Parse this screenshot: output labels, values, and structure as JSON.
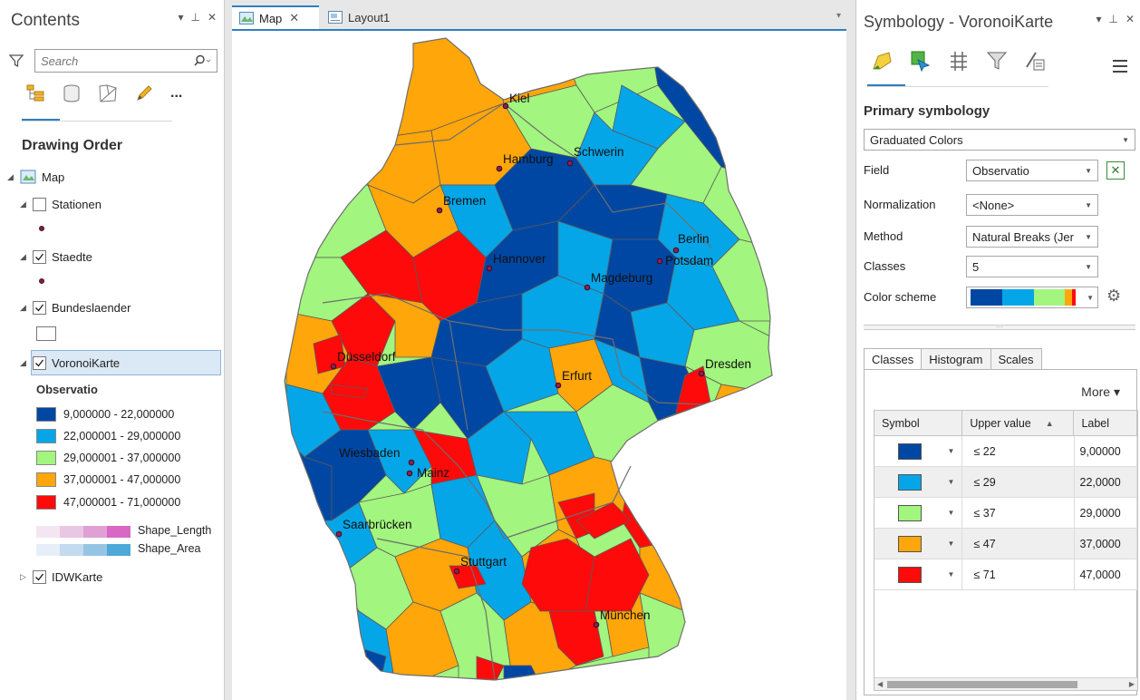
{
  "colors": {
    "class1": "#0047A3",
    "class2": "#04A6E8",
    "class3": "#A2F57E",
    "class4": "#FFA60A",
    "class5": "#FF0A0A",
    "accent": "#2F7FC1"
  },
  "contents": {
    "title": "Contents",
    "ctrl_dropdown": "▾",
    "ctrl_pin": "⊥",
    "ctrl_close": "✕",
    "search_placeholder": "Search",
    "more_label": "...",
    "drawing_order": "Drawing Order",
    "layers": {
      "map": "Map",
      "stationen": "Stationen",
      "staedte": "Staedte",
      "bundeslaender": "Bundeslaender",
      "voronoi": "VoronoiKarte",
      "idw": "IDWKarte"
    },
    "legend_field": "Observatio",
    "legend": [
      {
        "label": "9,000000 - 22,000000"
      },
      {
        "label": "22,000001 - 29,000000"
      },
      {
        "label": "29,000001 - 37,000000"
      },
      {
        "label": "37,000001 - 47,000000"
      },
      {
        "label": "47,000001 - 71,000000"
      }
    ],
    "shape_length": "Shape_Length",
    "shape_area": "Shape_Area"
  },
  "map": {
    "tabs": [
      {
        "label": "Map",
        "close": "✕"
      },
      {
        "label": "Layout1"
      }
    ],
    "tab_dropdown": "▾",
    "cities": [
      {
        "name": "Kiel"
      },
      {
        "name": "Schwerin"
      },
      {
        "name": "Hamburg"
      },
      {
        "name": "Bremen"
      },
      {
        "name": "Berlin"
      },
      {
        "name": "Potsdam"
      },
      {
        "name": "Hannover"
      },
      {
        "name": "Magdeburg"
      },
      {
        "name": "Düsseldorf"
      },
      {
        "name": "Erfurt"
      },
      {
        "name": "Dresden"
      },
      {
        "name": "Wiesbaden"
      },
      {
        "name": "Mainz"
      },
      {
        "name": "Saarbrücken"
      },
      {
        "name": "Stuttgart"
      },
      {
        "name": "München"
      }
    ]
  },
  "symbology": {
    "title": "Symbology - VoronoiKarte",
    "ctrl_dropdown": "▾",
    "ctrl_pin": "⊥",
    "ctrl_close": "✕",
    "primary_title": "Primary symbology",
    "renderer": "Graduated Colors",
    "field_label": "Field",
    "field_value": "Observatio",
    "normalization_label": "Normalization",
    "normalization_value": "<None>",
    "method_label": "Method",
    "method_value": "Natural Breaks (Jer",
    "classes_label": "Classes",
    "classes_value": "5",
    "scheme_label": "Color scheme",
    "tabs": [
      "Classes",
      "Histogram",
      "Scales"
    ],
    "more": "More ▾",
    "grid_headers": {
      "symbol": "Symbol",
      "upper": "Upper value",
      "label": "Label"
    },
    "rows": [
      {
        "upper": "≤  22",
        "label": "9,00000"
      },
      {
        "upper": "≤  29",
        "label": "22,0000"
      },
      {
        "upper": "≤  37",
        "label": "29,0000"
      },
      {
        "upper": "≤  47",
        "label": "37,0000"
      },
      {
        "upper": "≤  71",
        "label": "47,0000"
      }
    ]
  }
}
